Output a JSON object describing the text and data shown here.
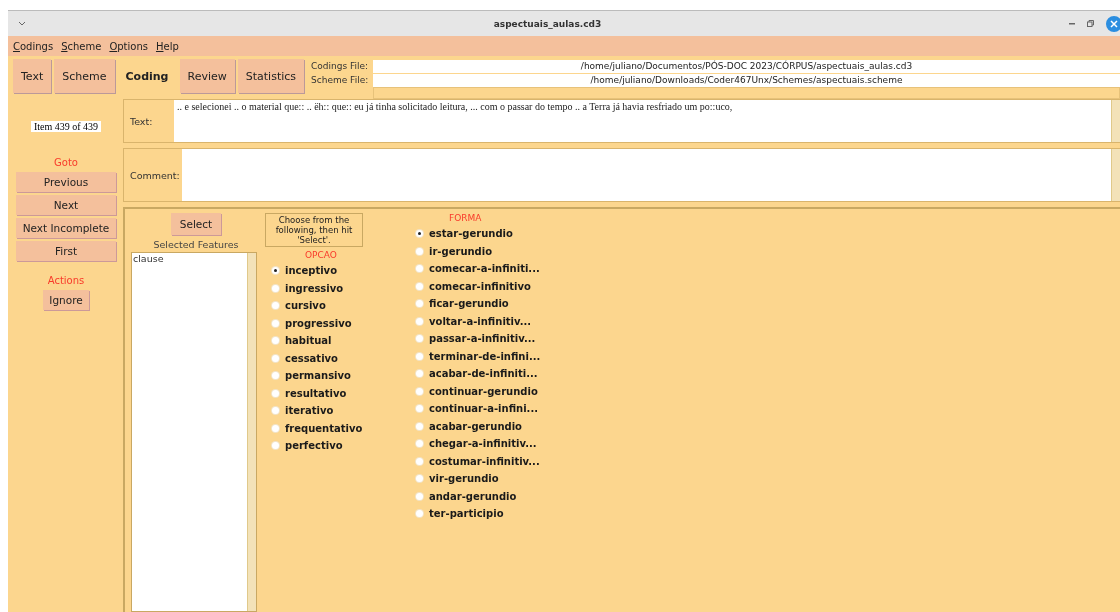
{
  "window": {
    "title": "aspectuais_aulas.cd3"
  },
  "menu": [
    "Codings",
    "Scheme",
    "Options",
    "Help"
  ],
  "tabs": [
    {
      "label": "Text",
      "selected": false
    },
    {
      "label": "Scheme",
      "selected": false
    },
    {
      "label": "Coding",
      "selected": true
    },
    {
      "label": "Review",
      "selected": false
    },
    {
      "label": "Statistics",
      "selected": false
    }
  ],
  "files": [
    {
      "label": "Codings File:",
      "value": "/home/juliano/Documentos/PÓS-DOC 2023/CÓRPUS/aspectuais_aulas.cd3"
    },
    {
      "label": "Scheme File:",
      "value": "/home/juliano/Downloads/Coder467Unx/Schemes/aspectuais.scheme"
    }
  ],
  "sidebar": {
    "counter": "Item 439 of 439",
    "goto_heading": "Goto",
    "goto_buttons": [
      "Previous",
      "Next",
      "Next Incomplete",
      "First"
    ],
    "actions_heading": "Actions",
    "action_buttons": [
      "Ignore"
    ]
  },
  "text_field": {
    "label": "Text:",
    "value": ".. e selecionei .. o material que:: .. ëh:: que:: eu já tinha solicitado leitura, ... com o passar do tempo .. a Terra já havia resfriado um po::uco,"
  },
  "comment_field": {
    "label": "Comment:"
  },
  "coding": {
    "select_button": "Select",
    "selected_features_label": "Selected Features",
    "selected_features": [
      "clause"
    ],
    "instruction": "Choose from the following, then hit 'Select'.",
    "groups": [
      {
        "heading": "OPCAO",
        "options": [
          {
            "label": "inceptivo",
            "selected": true
          },
          {
            "label": "ingressivo",
            "selected": false
          },
          {
            "label": "cursivo",
            "selected": false
          },
          {
            "label": "progressivo",
            "selected": false
          },
          {
            "label": "habitual",
            "selected": false
          },
          {
            "label": "cessativo",
            "selected": false
          },
          {
            "label": "permansivo",
            "selected": false
          },
          {
            "label": "resultativo",
            "selected": false
          },
          {
            "label": "iterativo",
            "selected": false
          },
          {
            "label": "frequentativo",
            "selected": false
          },
          {
            "label": "perfectivo",
            "selected": false
          }
        ]
      },
      {
        "heading": "FORMA",
        "options": [
          {
            "label": "estar-gerundio",
            "selected": true
          },
          {
            "label": "ir-gerundio",
            "selected": false
          },
          {
            "label": "comecar-a-infiniti...",
            "selected": false
          },
          {
            "label": "comecar-infinitivo",
            "selected": false
          },
          {
            "label": "ficar-gerundio",
            "selected": false
          },
          {
            "label": "voltar-a-infinitiv...",
            "selected": false
          },
          {
            "label": "passar-a-infinitiv...",
            "selected": false
          },
          {
            "label": "terminar-de-infini...",
            "selected": false
          },
          {
            "label": "acabar-de-infiniti...",
            "selected": false
          },
          {
            "label": "continuar-gerundio",
            "selected": false
          },
          {
            "label": "continuar-a-infini...",
            "selected": false
          },
          {
            "label": "acabar-gerundio",
            "selected": false
          },
          {
            "label": "chegar-a-infinitiv...",
            "selected": false
          },
          {
            "label": "costumar-infinitiv...",
            "selected": false
          },
          {
            "label": "vir-gerundio",
            "selected": false
          },
          {
            "label": "andar-gerundio",
            "selected": false
          },
          {
            "label": "ter-participio",
            "selected": false
          }
        ]
      }
    ]
  }
}
